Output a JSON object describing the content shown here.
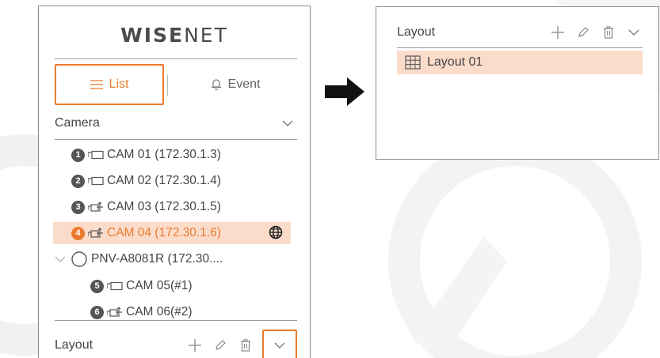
{
  "logo": {
    "brand_bold": "WISE",
    "brand_light": "NET"
  },
  "tabs": {
    "list_label": "List",
    "event_label": "Event"
  },
  "camera_section": {
    "label": "Camera"
  },
  "cameras": [
    {
      "badge": "1",
      "label": "CAM 01 (172.30.1.3)",
      "icon": "camera-box-icon"
    },
    {
      "badge": "2",
      "label": "CAM 02 (172.30.1.4)",
      "icon": "camera-box-icon"
    },
    {
      "badge": "3",
      "label": "CAM 03 (172.30.1.5)",
      "icon": "ptz-camera-icon"
    },
    {
      "badge": "4",
      "label": "CAM 04 (172.30.1.6)",
      "icon": "ptz-camera-icon",
      "selected": true
    }
  ],
  "device_group": {
    "label": "PNV-A8081R (172.30....",
    "icon": "radio-circle-icon"
  },
  "sub_cameras": [
    {
      "badge": "5",
      "label": "CAM 05(#1)",
      "icon": "camera-box-icon"
    },
    {
      "badge": "6",
      "label": "CAM 06(#2)",
      "icon": "ptz-camera-icon"
    }
  ],
  "layout_section": {
    "label": "Layout"
  },
  "right_panel": {
    "header_label": "Layout",
    "layouts": [
      {
        "label": "Layout 01",
        "icon": "grid-icon"
      }
    ]
  },
  "colors": {
    "accent": "#ea7b2f",
    "highlight": "#fbdccb",
    "text": "#444444",
    "badge": "#555555"
  }
}
